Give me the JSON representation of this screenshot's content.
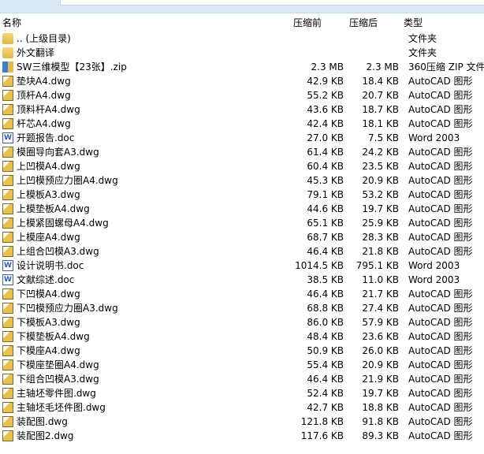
{
  "header": {
    "name": "名称",
    "before": "压缩前",
    "after": "压缩后",
    "type": "类型"
  },
  "files": [
    {
      "name": ".. (上级目录)",
      "before": "",
      "after": "",
      "type": "文件夹",
      "icon": "folder"
    },
    {
      "name": "外文翻译",
      "before": "",
      "after": "",
      "type": "文件夹",
      "icon": "folder"
    },
    {
      "name": "SW三维模型【23张】.zip",
      "before": "2.3 MB",
      "after": "2.3 MB",
      "type": "360压缩 ZIP 文件",
      "icon": "zip"
    },
    {
      "name": "垫块A4.dwg",
      "before": "42.9 KB",
      "after": "18.4 KB",
      "type": "AutoCAD 图形",
      "icon": "dwg"
    },
    {
      "name": "顶杆A4.dwg",
      "before": "55.2 KB",
      "after": "20.7 KB",
      "type": "AutoCAD 图形",
      "icon": "dwg"
    },
    {
      "name": "顶料杆A4.dwg",
      "before": "43.6 KB",
      "after": "18.7 KB",
      "type": "AutoCAD 图形",
      "icon": "dwg"
    },
    {
      "name": "杆芯A4.dwg",
      "before": "42.4 KB",
      "after": "18.1 KB",
      "type": "AutoCAD 图形",
      "icon": "dwg"
    },
    {
      "name": "开题报告.doc",
      "before": "27.0 KB",
      "after": "7.5 KB",
      "type": "Word 2003",
      "icon": "doc"
    },
    {
      "name": "模圈导向套A3.dwg",
      "before": "61.4 KB",
      "after": "24.2 KB",
      "type": "AutoCAD 图形",
      "icon": "dwg"
    },
    {
      "name": "上凹模A4.dwg",
      "before": "60.4 KB",
      "after": "23.5 KB",
      "type": "AutoCAD 图形",
      "icon": "dwg"
    },
    {
      "name": "上凹模预应力圈A4.dwg",
      "before": "45.3 KB",
      "after": "20.9 KB",
      "type": "AutoCAD 图形",
      "icon": "dwg"
    },
    {
      "name": "上模板A3.dwg",
      "before": "79.1 KB",
      "after": "53.2 KB",
      "type": "AutoCAD 图形",
      "icon": "dwg"
    },
    {
      "name": "上模垫板A4.dwg",
      "before": "44.6 KB",
      "after": "19.7 KB",
      "type": "AutoCAD 图形",
      "icon": "dwg"
    },
    {
      "name": "上模紧固螺母A4.dwg",
      "before": "65.1 KB",
      "after": "25.9 KB",
      "type": "AutoCAD 图形",
      "icon": "dwg"
    },
    {
      "name": "上模座A4.dwg",
      "before": "68.7 KB",
      "after": "28.3 KB",
      "type": "AutoCAD 图形",
      "icon": "dwg"
    },
    {
      "name": "上组合凹模A3.dwg",
      "before": "46.4 KB",
      "after": "21.8 KB",
      "type": "AutoCAD 图形",
      "icon": "dwg"
    },
    {
      "name": "设计说明书.doc",
      "before": "1014.5 KB",
      "after": "795.1 KB",
      "type": "Word 2003",
      "icon": "doc"
    },
    {
      "name": "文献综述.doc",
      "before": "38.5 KB",
      "after": "11.0 KB",
      "type": "Word 2003",
      "icon": "doc"
    },
    {
      "name": "下凹模A4.dwg",
      "before": "46.4 KB",
      "after": "21.7 KB",
      "type": "AutoCAD 图形",
      "icon": "dwg"
    },
    {
      "name": "下凹模预应力圈A3.dwg",
      "before": "68.8 KB",
      "after": "27.4 KB",
      "type": "AutoCAD 图形",
      "icon": "dwg"
    },
    {
      "name": "下模板A3.dwg",
      "before": "86.0 KB",
      "after": "57.9 KB",
      "type": "AutoCAD 图形",
      "icon": "dwg"
    },
    {
      "name": "下模垫板A4.dwg",
      "before": "48.4 KB",
      "after": "23.6 KB",
      "type": "AutoCAD 图形",
      "icon": "dwg"
    },
    {
      "name": "下模座A4.dwg",
      "before": "50.9 KB",
      "after": "26.0 KB",
      "type": "AutoCAD 图形",
      "icon": "dwg"
    },
    {
      "name": "下模座垫圈A4.dwg",
      "before": "55.4 KB",
      "after": "20.9 KB",
      "type": "AutoCAD 图形",
      "icon": "dwg"
    },
    {
      "name": "下组合凹模A3.dwg",
      "before": "46.4 KB",
      "after": "21.9 KB",
      "type": "AutoCAD 图形",
      "icon": "dwg"
    },
    {
      "name": "主轴坯零件图.dwg",
      "before": "52.4 KB",
      "after": "19.7 KB",
      "type": "AutoCAD 图形",
      "icon": "dwg"
    },
    {
      "name": "主轴坯毛坯件图.dwg",
      "before": "42.7 KB",
      "after": "18.8 KB",
      "type": "AutoCAD 图形",
      "icon": "dwg"
    },
    {
      "name": "装配图.dwg",
      "before": "121.8 KB",
      "after": "91.8 KB",
      "type": "AutoCAD 图形",
      "icon": "dwg"
    },
    {
      "name": "装配图2.dwg",
      "before": "117.6 KB",
      "after": "89.3 KB",
      "type": "AutoCAD 图形",
      "icon": "dwg"
    }
  ]
}
